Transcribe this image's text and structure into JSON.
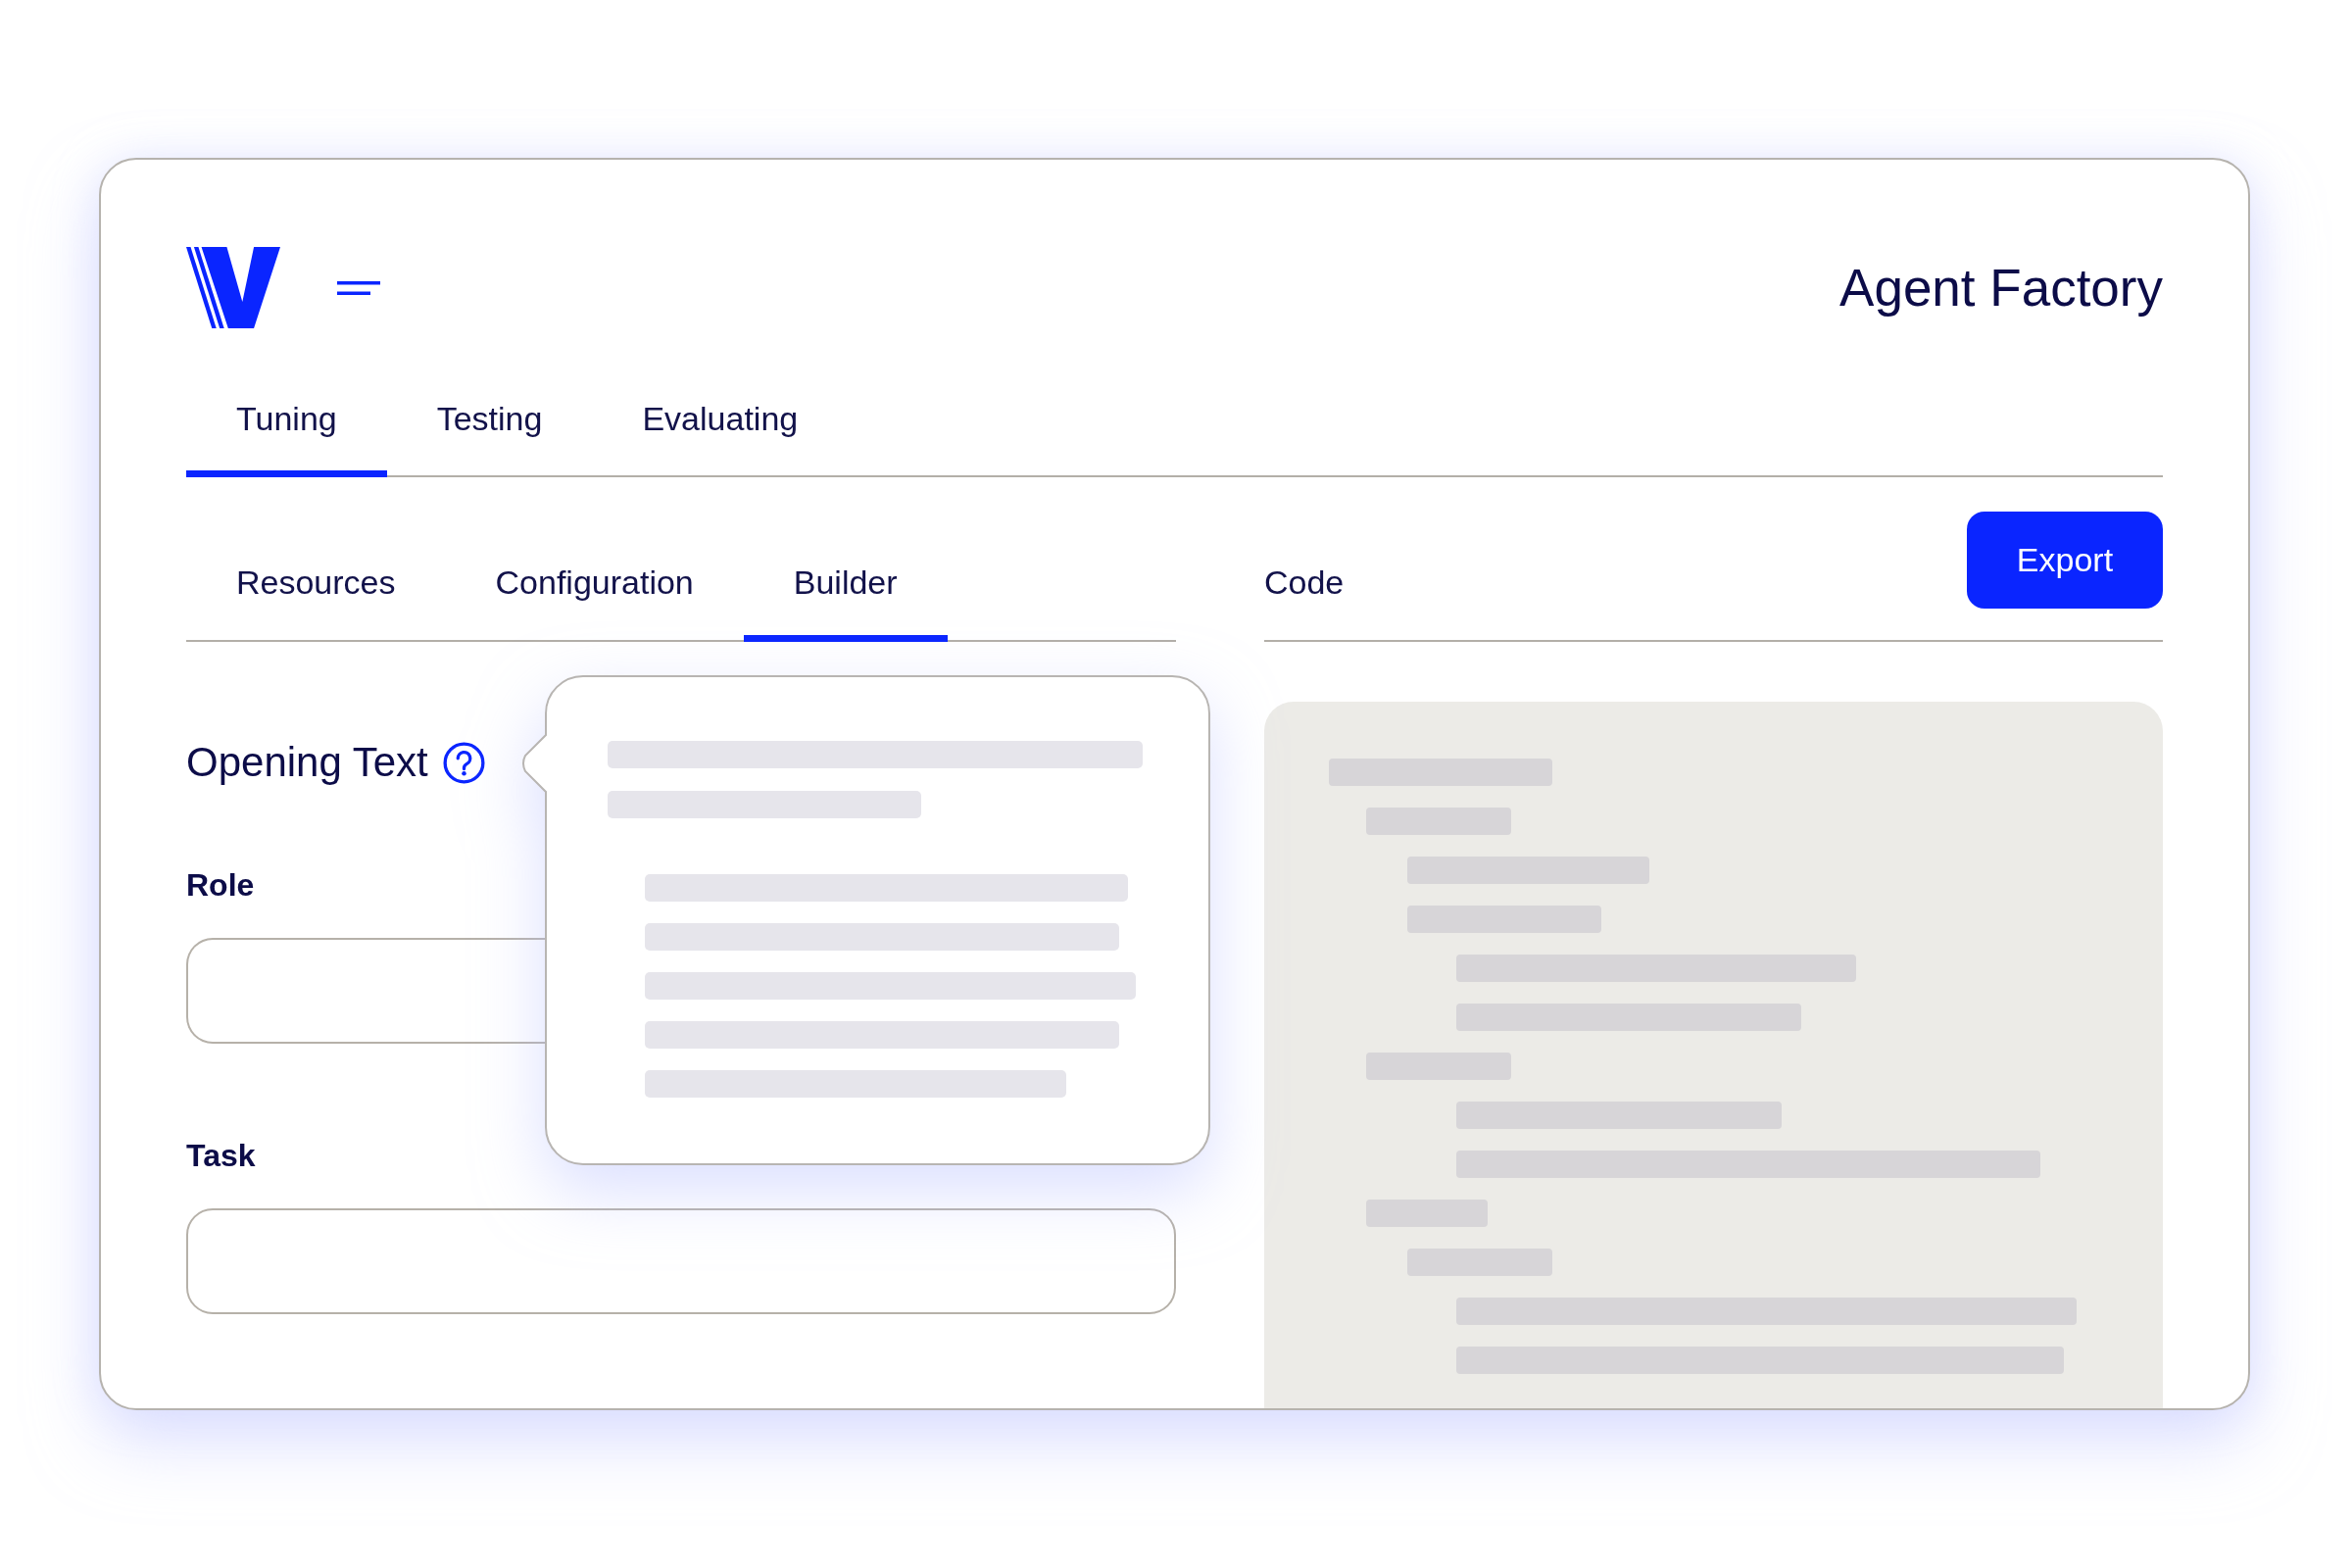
{
  "header": {
    "title": "Agent Factory"
  },
  "tabs": [
    {
      "label": "Tuning",
      "selected": true
    },
    {
      "label": "Testing",
      "selected": false
    },
    {
      "label": "Evaluating",
      "selected": false
    }
  ],
  "subtabs": [
    {
      "label": "Resources",
      "selected": false
    },
    {
      "label": "Configuration",
      "selected": false
    },
    {
      "label": "Builder",
      "selected": true
    }
  ],
  "form": {
    "heading": "Opening Text",
    "fields": [
      {
        "label": "Role"
      },
      {
        "label": "Task"
      }
    ]
  },
  "help_popover": {
    "open": true
  },
  "code_panel": {
    "title": "Code",
    "export_button": "Export"
  }
}
